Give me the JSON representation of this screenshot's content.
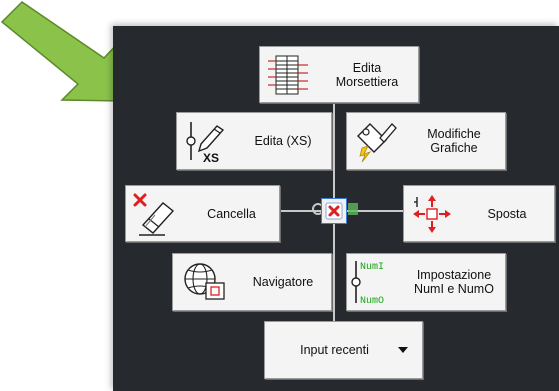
{
  "colors": {
    "panel_bg": "#26292e",
    "arrow_green": "#8bc34a",
    "button_bg": "#f4f4f4",
    "delete_red": "#e02020",
    "numi_green": "#17a317"
  },
  "radial_menu": {
    "edita_morsettiera": {
      "label": "Edita\nMorsettiera",
      "icon": "terminal-strip-icon"
    },
    "edita_xs": {
      "label": "Edita (XS)",
      "icon": "edit-xs-icon"
    },
    "modifiche_grafiche": {
      "label": "Modifiche\nGrafiche",
      "icon": "graphic-edit-icon"
    },
    "cancella": {
      "label": "Cancella",
      "icon": "eraser-delete-icon"
    },
    "sposta": {
      "label": "Sposta",
      "icon": "move-icon"
    },
    "navigatore": {
      "label": "Navigatore",
      "icon": "navigator-globe-icon"
    },
    "impostazione": {
      "label": "Impostazione\nNumI e NumO",
      "icon": "numi-numo-icon",
      "icon_text_top": "NumI",
      "icon_text_bottom": "NumO"
    },
    "input_recenti": {
      "label": "Input recenti",
      "icon": "chevron-down-icon"
    },
    "center": {
      "icon": "close-icon"
    }
  }
}
